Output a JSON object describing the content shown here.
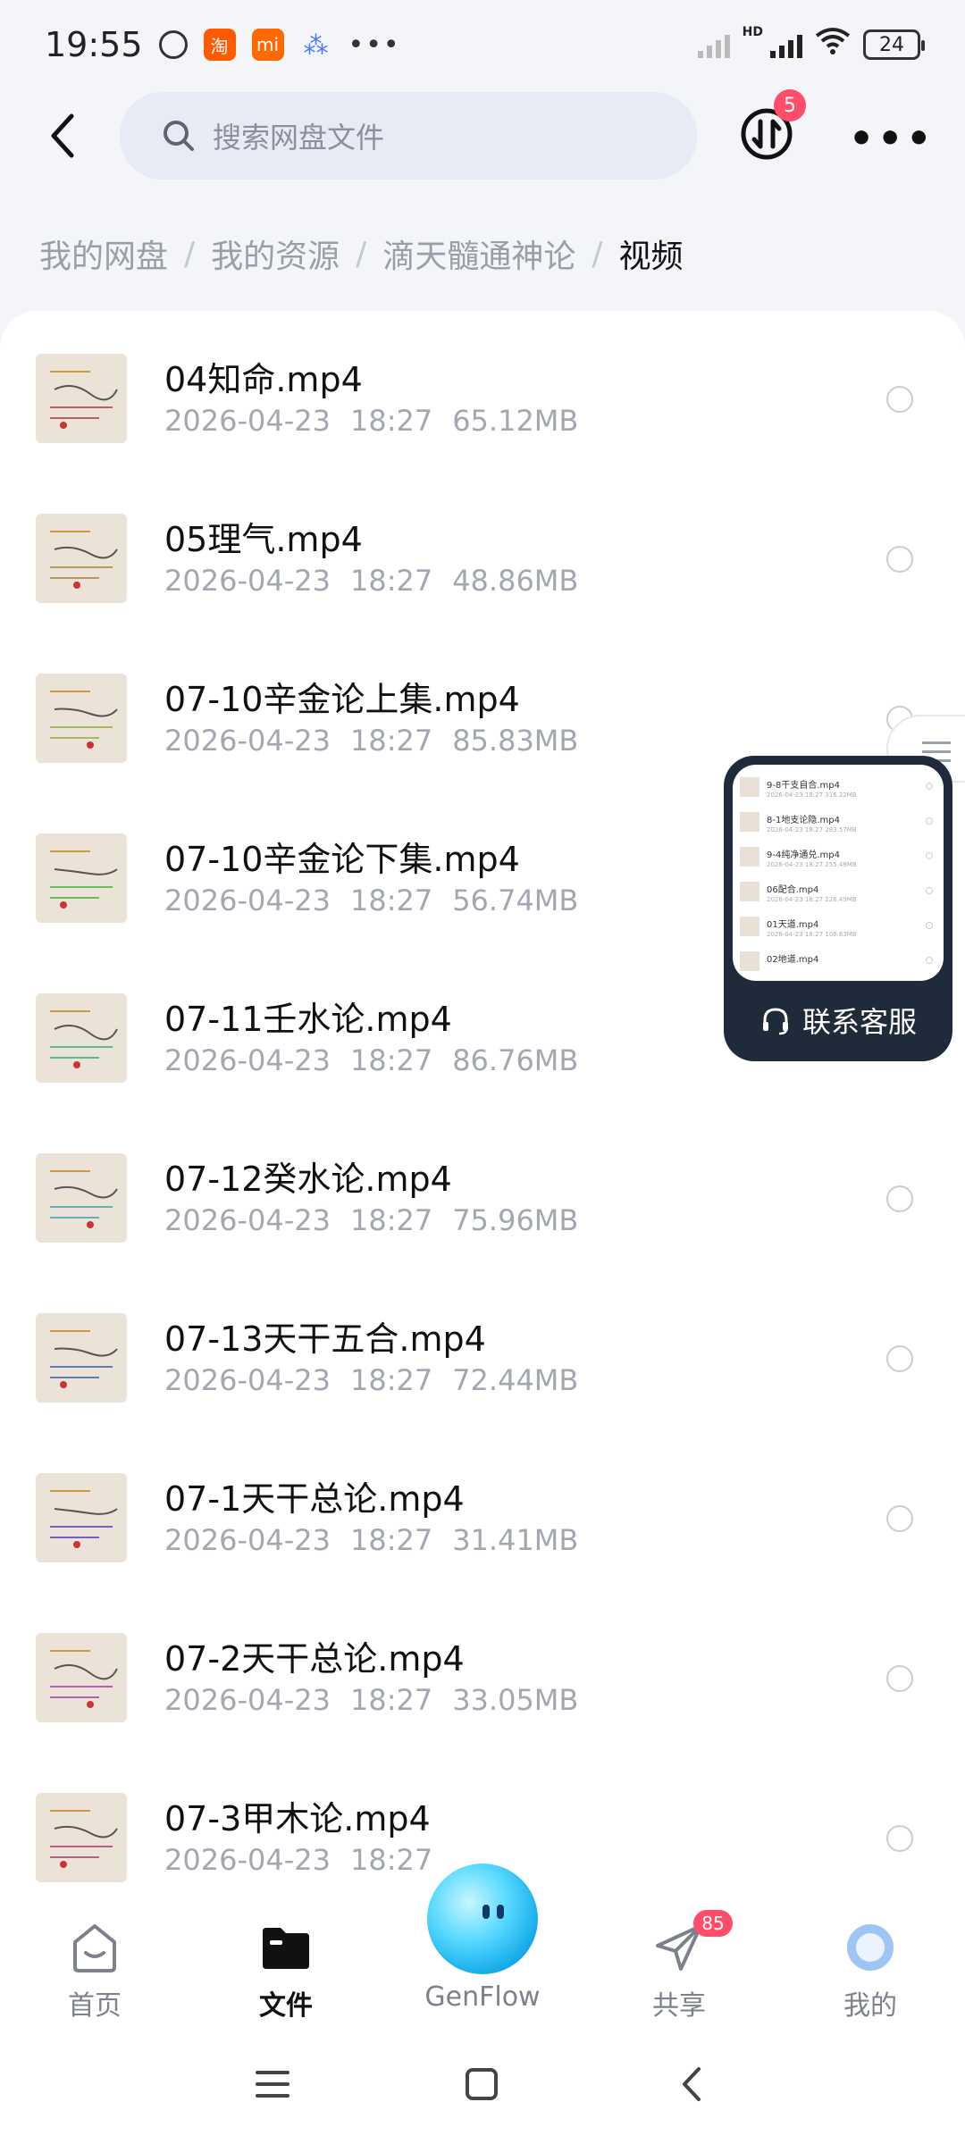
{
  "status_bar": {
    "time": "19:55",
    "taobao_icon": "淘",
    "mi_icon": "mi",
    "more": "•••",
    "hd": "HD",
    "battery": "24"
  },
  "header": {
    "search_placeholder": "搜索网盘文件",
    "transfer_badge": "5"
  },
  "breadcrumb": {
    "items": [
      "我的网盘",
      "我的资源",
      "滴天髓通神论"
    ],
    "separator": "/",
    "current": "视频"
  },
  "files": [
    {
      "name": "04知命.mp4",
      "date": "2026-04-23",
      "time": "18:27",
      "size": "65.12MB"
    },
    {
      "name": "05理气.mp4",
      "date": "2026-04-23",
      "time": "18:27",
      "size": "48.86MB"
    },
    {
      "name": "07-10辛金论上集.mp4",
      "date": "2026-04-23",
      "time": "18:27",
      "size": "85.83MB"
    },
    {
      "name": "07-10辛金论下集.mp4",
      "date": "2026-04-23",
      "time": "18:27",
      "size": "56.74MB"
    },
    {
      "name": "07-11壬水论.mp4",
      "date": "2026-04-23",
      "time": "18:27",
      "size": "86.76MB"
    },
    {
      "name": "07-12癸水论.mp4",
      "date": "2026-04-23",
      "time": "18:27",
      "size": "75.96MB"
    },
    {
      "name": "07-13天干五合.mp4",
      "date": "2026-04-23",
      "time": "18:27",
      "size": "72.44MB"
    },
    {
      "name": "07-1天干总论.mp4",
      "date": "2026-04-23",
      "time": "18:27",
      "size": "31.41MB"
    },
    {
      "name": "07-2天干总论.mp4",
      "date": "2026-04-23",
      "time": "18:27",
      "size": "33.05MB"
    },
    {
      "name": "07-3甲木论.mp4",
      "date": "2026-04-23",
      "time": "18:27",
      "size": ""
    }
  ],
  "float_window": {
    "label": "联系客服",
    "mini_rows": [
      {
        "name": "9-8干支自合.mp4",
        "meta": "2026-04-23 18:27 316.22MB"
      },
      {
        "name": "8-1地支论隐.mp4",
        "meta": "2026-04-23 18:27 283.57MB"
      },
      {
        "name": "9-4纯净通兑.mp4",
        "meta": "2026-04-23 18:27 255.48MB"
      },
      {
        "name": "06配合.mp4",
        "meta": "2026-04-23 18:27 226.49MB"
      },
      {
        "name": "01天道.mp4",
        "meta": "2026-04-23 18:27 108.63MB"
      },
      {
        "name": "02地道.mp4",
        "meta": ""
      }
    ]
  },
  "bottom_nav": {
    "home": "首页",
    "files": "文件",
    "genflow": "GenFlow",
    "share": "共享",
    "share_badge": "85",
    "me": "我的"
  },
  "colors": {
    "accent_badge": "#ff4d6a",
    "orb": "#12a9e8",
    "float_bg": "#1f2a3a"
  }
}
